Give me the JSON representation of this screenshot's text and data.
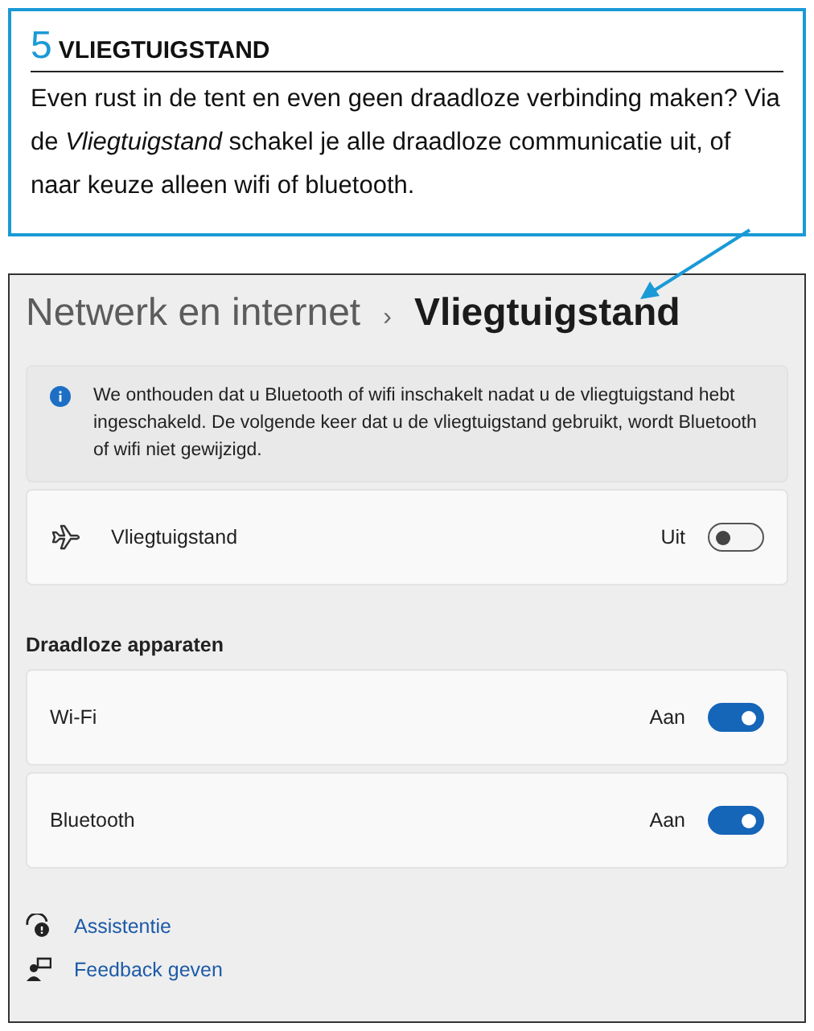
{
  "callout": {
    "number": "5",
    "title": "VLIEGTUIGSTAND",
    "text": "Even rust in de tent en even geen draadloze verbinding maken? Via de *Vliegtuigstand* schakel je alle draadloze communicatie uit, of naar keuze alleen wifi of bluetooth."
  },
  "settings": {
    "breadcrumb": [
      {
        "label": "Netwerk en internet",
        "current": false
      },
      {
        "label": "›",
        "kind": "separator"
      },
      {
        "label": "Vliegtuigstand",
        "current": true
      }
    ],
    "info": "We onthouden dat u Bluetooth of wifi inschakelt nadat u de vliegtuigstand hebt ingeschakeld. De volgende keer dat u de vliegtuigstand gebruikt, wordt Bluetooth of wifi niet gewijzigd.",
    "airplane": {
      "label": "Vliegtuigstand",
      "state_text": "Uit",
      "on": false
    },
    "section_title": "Draadloze apparaten",
    "devices": [
      {
        "label": "Wi-Fi",
        "state_text": "Aan",
        "on": true
      },
      {
        "label": "Bluetooth",
        "state_text": "Aan",
        "on": true
      }
    ],
    "links": [
      {
        "label": "Assistentie",
        "kind": "help"
      },
      {
        "label": "Feedback geven",
        "kind": "feedback"
      }
    ]
  }
}
